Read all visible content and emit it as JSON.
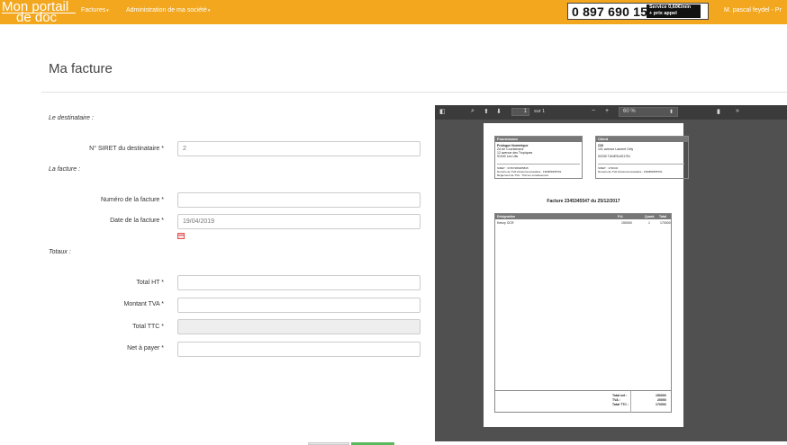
{
  "navbar": {
    "logo_line1": "Mon portail",
    "logo_line2": "de doc",
    "menu": [
      {
        "label": "Factures"
      },
      {
        "label": "Administration de ma société"
      }
    ],
    "phone": "0 897 690 157",
    "service_line1": "Service 0,60€/min",
    "service_line2": "+ prix appel",
    "user": "M. pascal feydel - Pr"
  },
  "page": {
    "title": "Ma facture"
  },
  "form": {
    "sections": {
      "recipient": "Le destinataire :",
      "invoice": "La facture :",
      "totals": "Totaux :"
    },
    "siret": {
      "label": "N° SIRET du destinataire *",
      "value": "2"
    },
    "invoice_number": {
      "label": "Numéro de la facture *",
      "value": ""
    },
    "invoice_date": {
      "label": "Date de la facture *",
      "value": "19/04/2019"
    },
    "total_ht": {
      "label": "Total HT *",
      "value": ""
    },
    "vat_amount": {
      "label": "Montant TVA *",
      "value": ""
    },
    "total_ttc": {
      "label": "Total TTC *",
      "value": ""
    },
    "net_to_pay": {
      "label": "Net à payer *",
      "value": ""
    }
  },
  "pdf_viewer": {
    "page_number": "1",
    "page_count": "sur 1",
    "zoom": "60 %",
    "document": {
      "supplier": {
        "header": "Fournisseur",
        "name": "Prologue Numérique",
        "address1": "ZA de Courtaboeuf",
        "address2": "12 avenue des Tropiques",
        "address3": "91940 Les Ulis",
        "siret": "SIRET : 37457486485845",
        "vat": "Numéro de TVA intracommunautaire : FR4859355701",
        "legal": "Règlement de TVA : TVA sur encaissement"
      },
      "client": {
        "header": "Client",
        "name": "CDI",
        "address1": "101 avenue Laurent Cély",
        "address2": "",
        "address3": "92230 TUNESUIS1751",
        "siret": "SIRET : 1730CD",
        "vat": "Numéro de TVA intracommunautaire : FR4859355701"
      },
      "title": "Facture 2345345547 du 25/12/2017",
      "columns": [
        "Désignation",
        "P.U.",
        "Quant.",
        "Total"
      ],
      "rows": [
        {
          "designation": "Kenzy OCR",
          "pu": "150000",
          "qty": "1",
          "total": "170000"
        }
      ],
      "totals": [
        {
          "label": "Total net :",
          "value": "150000"
        },
        {
          "label": "TVA :",
          "value": "20000"
        },
        {
          "label": "Total TTC :",
          "value": "170000"
        }
      ]
    }
  },
  "colors": {
    "navbar": "#f2a71f",
    "viewer_bg": "#505050",
    "toolbar_bg": "#3b3b3b"
  }
}
